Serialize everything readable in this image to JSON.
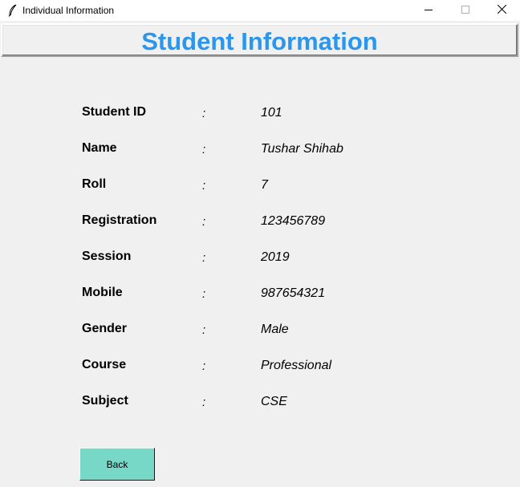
{
  "window": {
    "title": "Individual Information"
  },
  "header": {
    "title": "Student Information",
    "color": "#2b96ee"
  },
  "fields": [
    {
      "label": "Student ID",
      "colon": ":",
      "value": "101"
    },
    {
      "label": "Name",
      "colon": ":",
      "value": "Tushar Shihab"
    },
    {
      "label": "Roll",
      "colon": ":",
      "value": "7"
    },
    {
      "label": "Registration",
      "colon": ":",
      "value": "123456789"
    },
    {
      "label": "Session",
      "colon": ":",
      "value": "2019"
    },
    {
      "label": "Mobile",
      "colon": ":",
      "value": "987654321"
    },
    {
      "label": "Gender",
      "colon": ":",
      "value": "Male"
    },
    {
      "label": "Course",
      "colon": ":",
      "value": "Professional"
    },
    {
      "label": "Subject",
      "colon": ":",
      "value": "CSE"
    }
  ],
  "buttons": {
    "back_label": "Back",
    "back_color": "#78d8c8"
  }
}
